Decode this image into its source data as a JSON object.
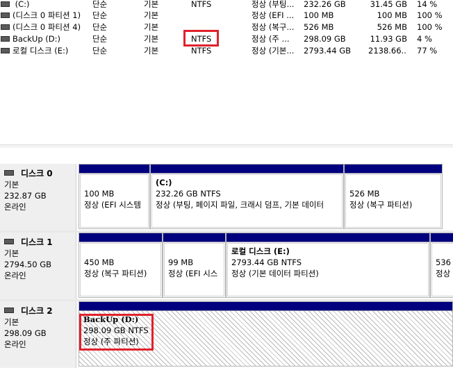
{
  "volumes": [
    {
      "name": "(C:)",
      "layout": "단순",
      "type": "기본",
      "fs": "NTFS",
      "status": "정상 (부팅...",
      "capacity": "232.26 GB",
      "free": "31.45 GB",
      "pct": "14 %"
    },
    {
      "name": "(디스크 0 파티션 1)",
      "layout": "단순",
      "type": "기본",
      "fs": "",
      "status": "정상 (EFI ...",
      "capacity": "100 MB",
      "free": "100 MB",
      "pct": "100 %"
    },
    {
      "name": "(디스크 0 파티션 4)",
      "layout": "단순",
      "type": "기본",
      "fs": "",
      "status": "정상 (복구...",
      "capacity": "526 MB",
      "free": "526 MB",
      "pct": "100 %"
    },
    {
      "name": "BackUp (D:)",
      "layout": "단순",
      "type": "기본",
      "fs": "NTFS",
      "status": "정상 (주 ...",
      "capacity": "298.09 GB",
      "free": "11.93 GB",
      "pct": "4 %"
    },
    {
      "name": "로컬 디스크 (E:)",
      "layout": "단순",
      "type": "기본",
      "fs": "NTFS",
      "status": "정상 (기본...",
      "capacity": "2793.44 GB",
      "free": "2138.66...",
      "pct": "77 %"
    }
  ],
  "disks": [
    {
      "name": "디스크 0",
      "type": "기본",
      "size": "232.87 GB",
      "state": "온라인",
      "partitions": [
        {
          "title": "",
          "size": "100 MB",
          "status": "정상 (EFI 시스템"
        },
        {
          "title": "(C:)",
          "size": "232.26 GB NTFS",
          "status": "정상 (부팅, 페이지 파일, 크래시 덤프, 기본 데이터"
        },
        {
          "title": "",
          "size": "526 MB",
          "status": "정상 (복구 파티션)"
        }
      ]
    },
    {
      "name": "디스크 1",
      "type": "기본",
      "size": "2794.50 GB",
      "state": "온라인",
      "partitions": [
        {
          "title": "",
          "size": "450 MB",
          "status": "정상 (복구 파티션)"
        },
        {
          "title": "",
          "size": "99 MB",
          "status": "정상 (EFI 시스"
        },
        {
          "title": "로컬 디스크  (E:)",
          "size": "2793.44 GB NTFS",
          "status": "정상 (기본 데이터 파티션)"
        },
        {
          "title": "",
          "size": "536",
          "status": "정상"
        }
      ]
    },
    {
      "name": "디스크 2",
      "type": "기본",
      "size": "298.09 GB",
      "state": "온라인",
      "partitions": [
        {
          "title": "BackUp  (D:)",
          "size": "298.09 GB NTFS",
          "status": "정상 (주 파티션)"
        }
      ]
    }
  ],
  "colors": {
    "partition_bar": "#00007f",
    "highlight": "#e0212b"
  }
}
